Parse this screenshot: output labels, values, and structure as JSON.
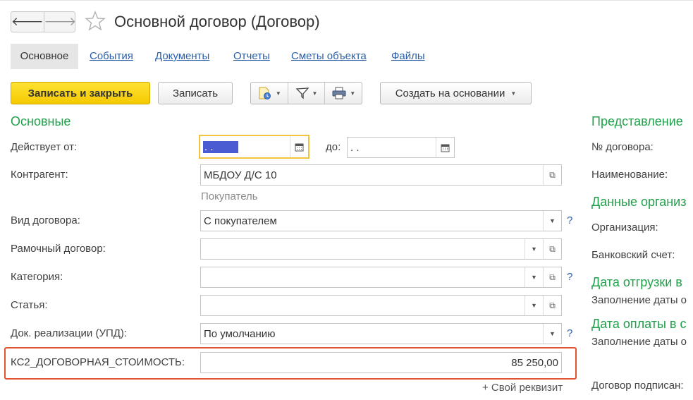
{
  "window": {
    "title": "Основной договор (Договор)",
    "back_glyph": "🡐",
    "forward_glyph": "🡒"
  },
  "tabs": [
    {
      "label": "Основное"
    },
    {
      "label": "События"
    },
    {
      "label": "Документы"
    },
    {
      "label": "Отчеты"
    },
    {
      "label": "Сметы объекта"
    },
    {
      "label": "Файлы"
    }
  ],
  "toolbar": {
    "save_close": "Записать и закрыть",
    "save": "Записать",
    "create_based": "Создать на основании",
    "icons": [
      "report-icon",
      "filter-icon",
      "print-icon"
    ]
  },
  "form": {
    "section_main": "Основные",
    "valid_from_label": "Действует от:",
    "valid_from_value": " .  . ",
    "to_label": "до:",
    "to_value": " .  . ",
    "counterparty_label": "Контрагент:",
    "counterparty_value": "МБДОУ Д/С 10",
    "counterparty_hint": "Покупатель",
    "contract_type_label": "Вид договора:",
    "contract_type_value": "С покупателем",
    "frame_contract_label": "Рамочный договор:",
    "frame_contract_value": "",
    "category_label": "Категория:",
    "category_value": "",
    "article_label": "Статья:",
    "article_value": "",
    "sales_doc_label": "Док. реализации (УПД):",
    "sales_doc_value": "По умолчанию",
    "ks2_label": "КС2_ДОГОВОРНАЯ_СТОИМОСТЬ:",
    "ks2_value": "85 250,00",
    "own_attr": "+ Свой реквизит",
    "help": "?"
  },
  "right": {
    "presentation": "Представление",
    "contract_no": "№ договора:",
    "name": "Наименование:",
    "org_data": "Данные организ",
    "organization": "Организация:",
    "bank_account": "Банковский счет:",
    "ship_date": "Дата отгрузки в",
    "ship_fill": "Заполнение даты о",
    "pay_date": "Дата оплаты в с",
    "pay_fill": "Заполнение даты о",
    "signed_by": "Договор подписан:"
  },
  "colors": {
    "accent_green": "#20a04a",
    "link_blue": "#2a5ea8",
    "primary_yellow": "#f4c900",
    "highlight_red": "#e2542f"
  }
}
